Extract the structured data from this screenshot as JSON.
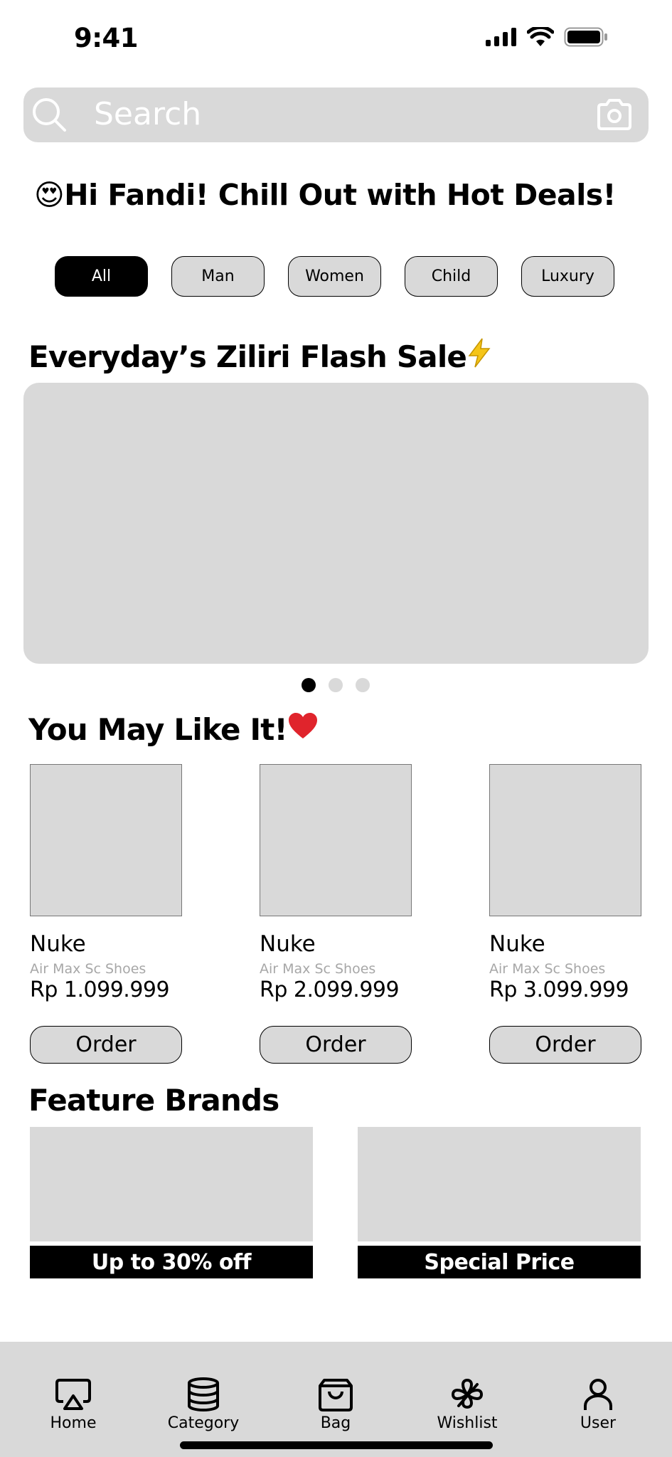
{
  "status_bar": {
    "time": "9:41"
  },
  "search": {
    "placeholder": "Search"
  },
  "greeting": {
    "emoji": "😍",
    "text": "Hi Fandi! Chill Out with Hot Deals!"
  },
  "categories": [
    {
      "label": "All",
      "active": true
    },
    {
      "label": "Man",
      "active": false
    },
    {
      "label": "Women",
      "active": false
    },
    {
      "label": "Child",
      "active": false
    },
    {
      "label": "Luxury",
      "active": false
    }
  ],
  "flash_sale": {
    "title": "Everyday’s Ziliri Flash Sale",
    "emoji": "⚡",
    "slides": 3,
    "active_slide": 1
  },
  "recommendations": {
    "title": "You May Like It!",
    "emoji": "❤️",
    "products": [
      {
        "brand": "Nuke",
        "name": "Air Max Sc Shoes",
        "price": "Rp 1.099.999",
        "button": "Order"
      },
      {
        "brand": "Nuke",
        "name": "Air Max Sc Shoes",
        "price": "Rp 2.099.999",
        "button": "Order"
      },
      {
        "brand": "Nuke",
        "name": "Air Max Sc Shoes",
        "price": "Rp 3.099.999",
        "button": "Order"
      }
    ]
  },
  "brands": {
    "title": "Feature Brands",
    "items": [
      {
        "label": "Up to 30% off"
      },
      {
        "label": "Special Price"
      }
    ]
  },
  "tabs": [
    {
      "label": "Home",
      "icon": "airplay-icon"
    },
    {
      "label": "Category",
      "icon": "database-icon"
    },
    {
      "label": "Bag",
      "icon": "shopping-bag-icon"
    },
    {
      "label": "Wishlist",
      "icon": "clover-icon"
    },
    {
      "label": "User",
      "icon": "user-icon"
    }
  ],
  "colors": {
    "placeholder_gray": "#d9d9d9",
    "accent": "#000000",
    "text_muted": "#a7a7a7",
    "flash_icon": "#f5c518",
    "heart": "#e0242c"
  }
}
